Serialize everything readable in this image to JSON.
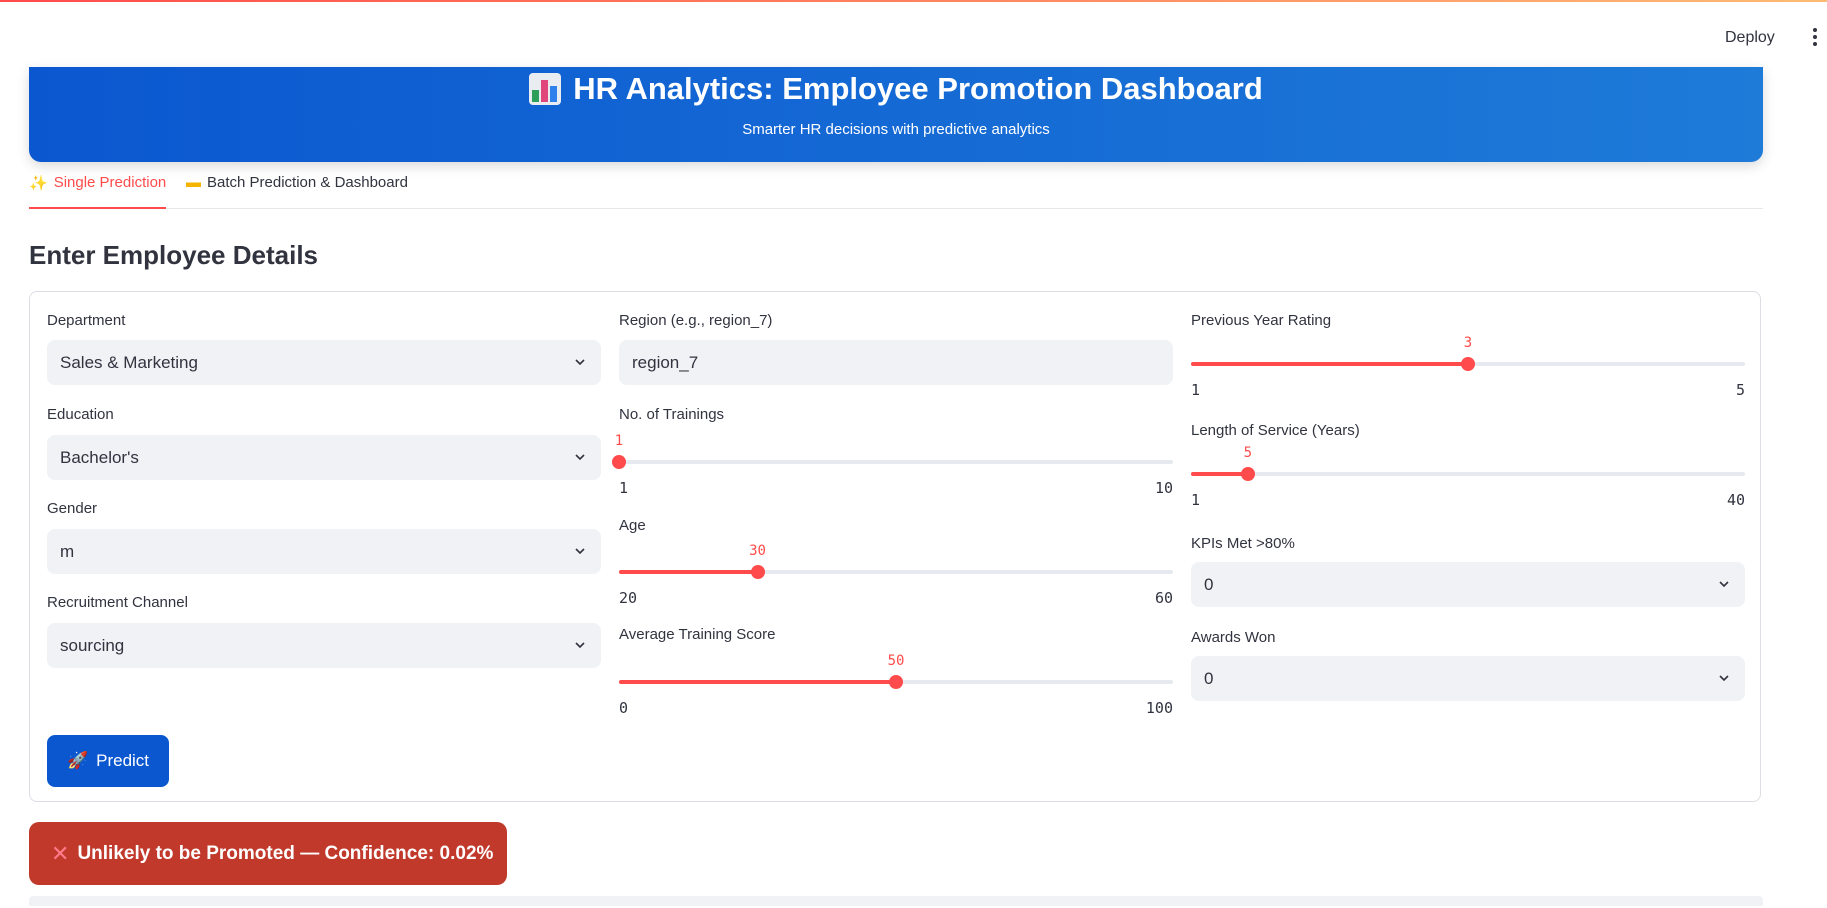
{
  "header": {
    "deploy_label": "Deploy"
  },
  "banner": {
    "title": "HR Analytics: Employee Promotion Dashboard",
    "subtitle": "Smarter HR decisions with predictive analytics"
  },
  "tabs": [
    {
      "label": "Single Prediction",
      "icon": "sparkles-icon"
    },
    {
      "label": "Batch Prediction & Dashboard",
      "icon": "folder-icon"
    }
  ],
  "section_title": "Enter Employee Details",
  "form": {
    "department": {
      "label": "Department",
      "value": "Sales & Marketing"
    },
    "education": {
      "label": "Education",
      "value": "Bachelor's"
    },
    "gender": {
      "label": "Gender",
      "value": "m"
    },
    "recruitment_channel": {
      "label": "Recruitment Channel",
      "value": "sourcing"
    },
    "region": {
      "label": "Region (e.g., region_7)",
      "value": "region_7"
    },
    "trainings": {
      "label": "No. of Trainings",
      "value": 1,
      "min": 1,
      "max": 10
    },
    "age": {
      "label": "Age",
      "value": 30,
      "min": 20,
      "max": 60
    },
    "avg_training_score": {
      "label": "Average Training Score",
      "value": 50,
      "min": 0,
      "max": 100
    },
    "prev_year_rating": {
      "label": "Previous Year Rating",
      "value": 3,
      "min": 1,
      "max": 5
    },
    "length_of_service": {
      "label": "Length of Service (Years)",
      "value": 5,
      "min": 1,
      "max": 40
    },
    "kpis_met": {
      "label": "KPIs Met >80%",
      "value": "0"
    },
    "awards_won": {
      "label": "Awards Won",
      "value": "0"
    }
  },
  "predict_button": {
    "label": "Predict",
    "icon": "rocket-icon"
  },
  "result": {
    "text": "Unlikely to be Promoted — Confidence: 0.02%",
    "icon": "cross-mark-icon"
  },
  "colors": {
    "accent": "#ff4b4b",
    "primary": "#0b57d0",
    "danger": "#c0392b"
  }
}
